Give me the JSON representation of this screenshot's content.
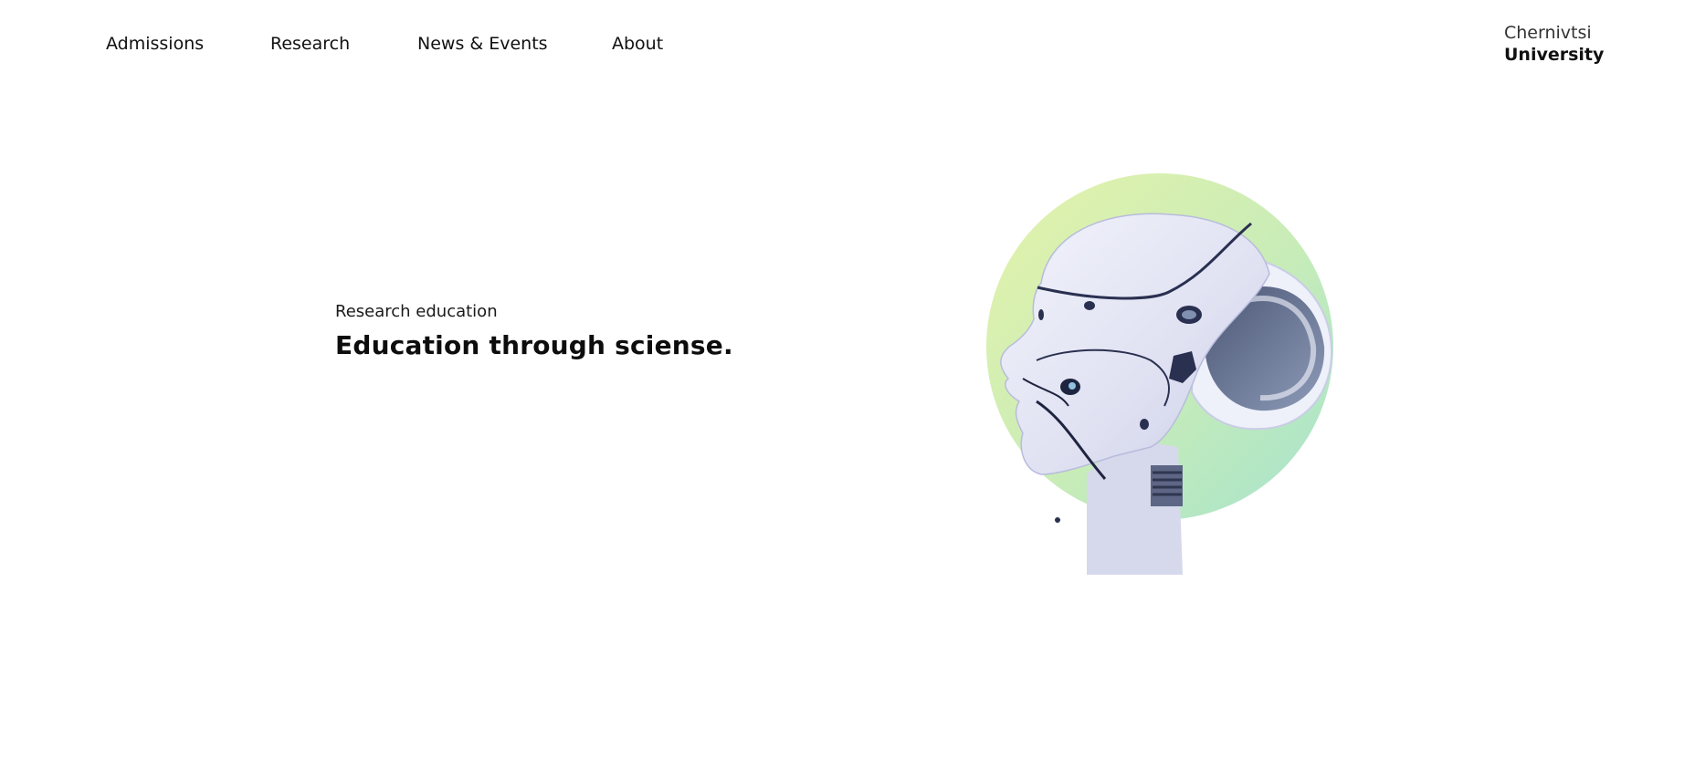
{
  "nav": {
    "items": [
      {
        "label": "Admissions"
      },
      {
        "label": "Research"
      },
      {
        "label": "News & Events"
      },
      {
        "label": "About"
      }
    ]
  },
  "brand": {
    "line1": "Chernivtsi",
    "line2": "University"
  },
  "hero": {
    "eyebrow": "Research education",
    "headline": "Education through sciense.",
    "image_icon": "robot-head-illustration",
    "accent_gradient": [
      "#e2f2ad",
      "#a8e6c9"
    ]
  }
}
